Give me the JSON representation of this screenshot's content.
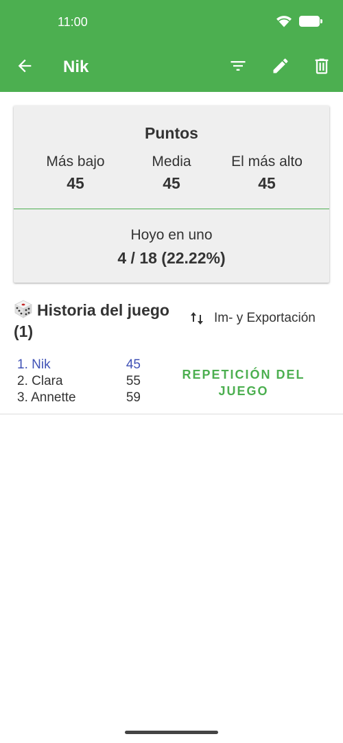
{
  "status_bar": {
    "time": "11:00"
  },
  "app_bar": {
    "title": "Nik"
  },
  "stats_card": {
    "title": "Puntos",
    "lowest_label": "Más bajo",
    "lowest_value": "45",
    "average_label": "Media",
    "average_value": "45",
    "highest_label": "El más alto",
    "highest_value": "45",
    "hole_in_one_label": "Hoyo en uno",
    "hole_in_one_value": "4 / 18 (22.22%)"
  },
  "history": {
    "title": "Historia del juego (1)",
    "export_label": "Im- y Exportación"
  },
  "game": {
    "players": [
      {
        "name": "1. Nik",
        "score": "45"
      },
      {
        "name": "2. Clara",
        "score": "55"
      },
      {
        "name": "3. Annette",
        "score": "59"
      }
    ],
    "replay_label": "REPETICIÓN DEL JUEGO"
  },
  "colors": {
    "primary": "#4caf50",
    "highlight": "#3f51b5",
    "card_bg": "#efefef"
  },
  "icons": [
    "wifi-icon",
    "battery-icon",
    "back-arrow-icon",
    "filter-icon",
    "edit-icon",
    "delete-icon",
    "dice-icon",
    "import-export-icon"
  ]
}
